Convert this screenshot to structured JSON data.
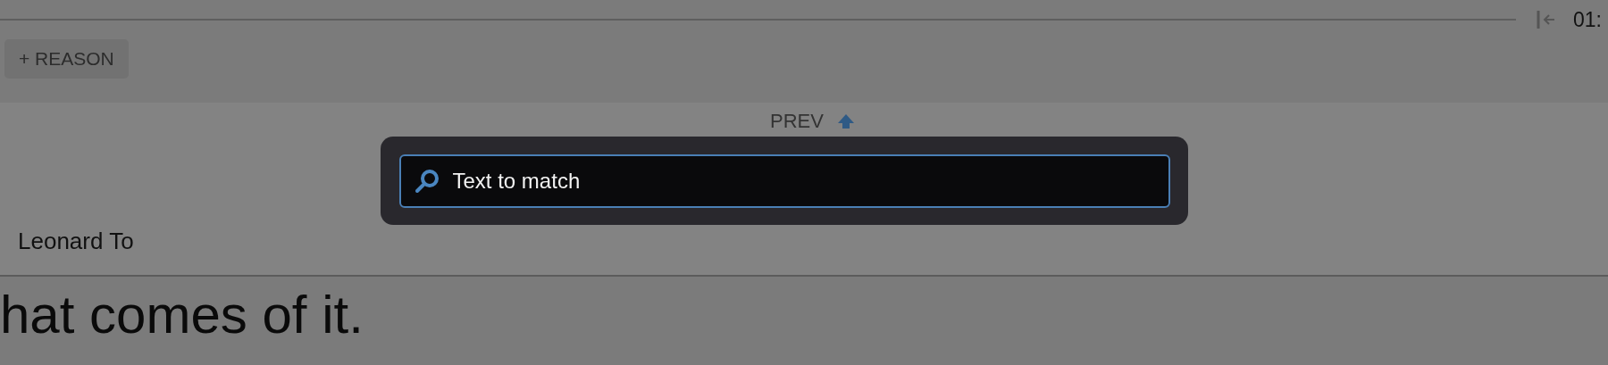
{
  "header": {
    "time": "01:"
  },
  "reason_button": {
    "label": "+ REASON"
  },
  "prev_button": {
    "label": "PREV"
  },
  "speaker": "Leonard To",
  "line_text": "hat comes of it.",
  "search_dialog": {
    "placeholder": "Text to match"
  }
}
